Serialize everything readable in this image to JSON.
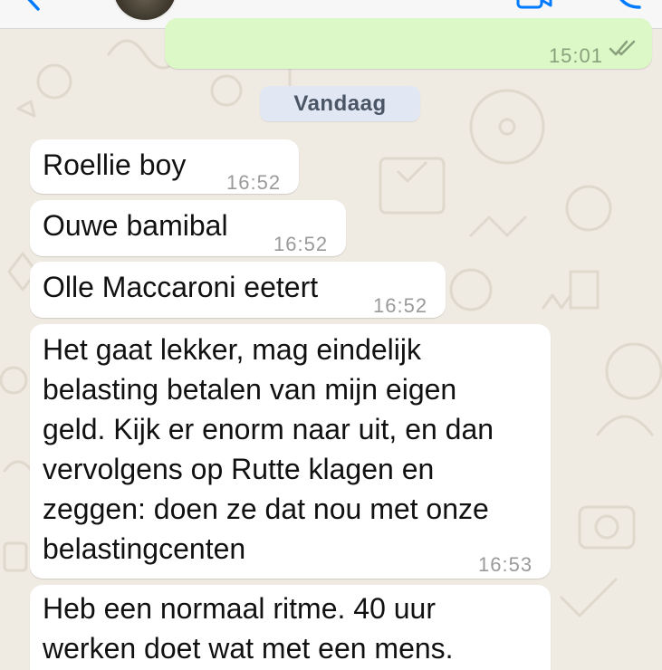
{
  "header": {
    "back_icon": "chevron-left-icon",
    "video_icon": "video-camera-icon",
    "call_icon": "phone-icon",
    "accent_color": "#007aff"
  },
  "outgoing_partial": {
    "time": "15:01",
    "status_icon": "double-check-icon"
  },
  "date_separator": "Vandaag",
  "messages": [
    {
      "text": "Roellie boy",
      "time": "16:52"
    },
    {
      "text": "Ouwe bamibal",
      "time": "16:52"
    },
    {
      "text": "Olle Maccaroni eetert",
      "time": "16:52"
    },
    {
      "text": "Het gaat lekker, mag eindelijk\nbelasting betalen van mijn eigen\ngeld. Kijk er enorm naar uit, en dan\nvervolgens op Rutte klagen en\nzeggen: doen ze dat nou met onze\nbelastingcenten",
      "time": "16:53"
    },
    {
      "text": "Heb een normaal ritme. 40 uur\nwerken doet wat met een mens.",
      "time": ""
    }
  ],
  "colors": {
    "incoming_bubble": "#ffffff",
    "outgoing_bubble": "#dcf8c6",
    "wallpaper": "#efeae2",
    "date_pill": "#e1e8f3"
  }
}
